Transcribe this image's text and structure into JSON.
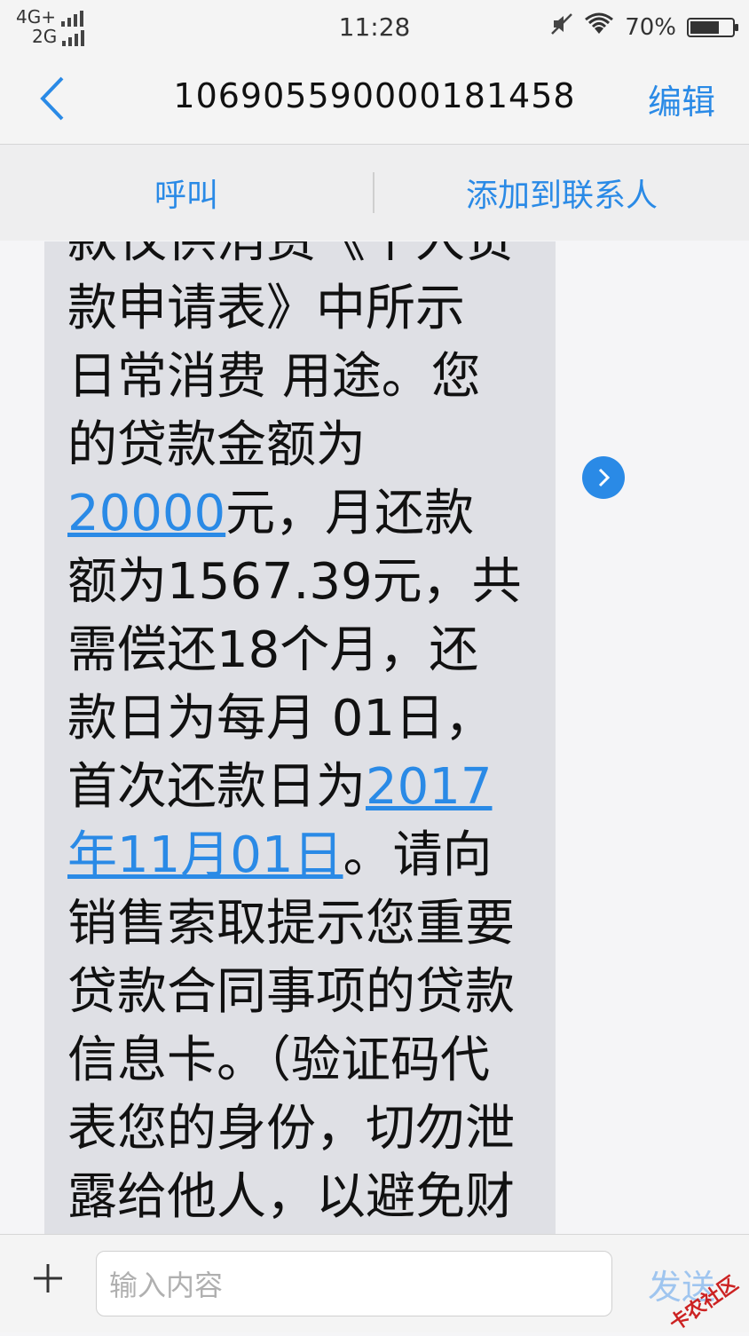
{
  "status_bar": {
    "network_top": "4G+",
    "network_bottom": "2G",
    "time": "11:28",
    "battery_percent": "70%",
    "battery_level": 0.7,
    "icons": [
      "mute-icon",
      "wifi-icon",
      "battery-icon"
    ]
  },
  "nav": {
    "back_icon": "chevron-left-icon",
    "title": "106905590000181458",
    "edit_label": "编辑"
  },
  "actions": {
    "call_label": "呼叫",
    "add_contact_label": "添加到联系人"
  },
  "message": {
    "seg_1": "款仅供消费《个人贷\n款申请表》中所示\n日常消费 用途。您\n的贷款金额为\n",
    "link_amount": "20000",
    "seg_2": "元，月还款\n额为1567.39元，共\n需偿还18个月，还\n款日为每月 01日，\n首次还款日为",
    "link_date": "2017\n年11月01日",
    "seg_3": "。请向\n销售索取提示您重要\n贷款合同事项的贷款\n信息卡。（验证码代\n表您的身份，切勿泄\n露给他人，以避免财"
  },
  "composer": {
    "plus_icon": "plus-icon",
    "input_placeholder": "输入内容",
    "send_label": "发送",
    "watermark_text": "卡农社区"
  },
  "colors": {
    "accent": "#2a8ae6",
    "bubble": "#dfe0e5",
    "bar_bg": "#f4f4f4"
  }
}
